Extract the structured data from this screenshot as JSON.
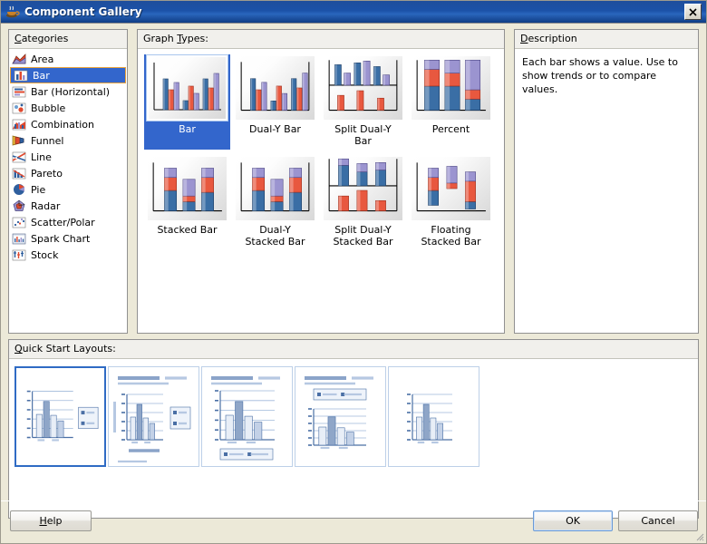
{
  "window": {
    "title": "Component Gallery",
    "icon": "java-coffee-cup-icon",
    "close_label": "✕"
  },
  "categories": {
    "header": "Categories",
    "header_mnemonic": "C",
    "selected": "Bar",
    "items": [
      {
        "label": "Area",
        "icon": "area-chart-icon"
      },
      {
        "label": "Bar",
        "icon": "bar-chart-icon"
      },
      {
        "label": "Bar (Horizontal)",
        "icon": "horizontal-bar-chart-icon"
      },
      {
        "label": "Bubble",
        "icon": "bubble-chart-icon"
      },
      {
        "label": "Combination",
        "icon": "combination-chart-icon"
      },
      {
        "label": "Funnel",
        "icon": "funnel-chart-icon"
      },
      {
        "label": "Line",
        "icon": "line-chart-icon"
      },
      {
        "label": "Pareto",
        "icon": "pareto-chart-icon"
      },
      {
        "label": "Pie",
        "icon": "pie-chart-icon"
      },
      {
        "label": "Radar",
        "icon": "radar-chart-icon"
      },
      {
        "label": "Scatter/Polar",
        "icon": "scatter-chart-icon"
      },
      {
        "label": "Spark Chart",
        "icon": "spark-chart-icon"
      },
      {
        "label": "Stock",
        "icon": "stock-chart-icon"
      }
    ]
  },
  "graph_types": {
    "header": "Graph Types:",
    "header_mnemonic": "T",
    "selected": "Bar",
    "items": [
      {
        "label": "Bar",
        "thumb": "bar"
      },
      {
        "label": "Dual-Y Bar",
        "thumb": "dual-y-bar"
      },
      {
        "label": "Split Dual-Y\nBar",
        "thumb": "split-dual-y-bar"
      },
      {
        "label": "Percent",
        "thumb": "percent"
      },
      {
        "label": "Stacked Bar",
        "thumb": "stacked-bar"
      },
      {
        "label": "Dual-Y\nStacked Bar",
        "thumb": "dual-y-stacked-bar"
      },
      {
        "label": "Split Dual-Y\nStacked Bar",
        "thumb": "split-dual-y-stacked-bar"
      },
      {
        "label": "Floating\nStacked Bar",
        "thumb": "floating-stacked-bar"
      }
    ]
  },
  "description": {
    "header": "Description",
    "header_mnemonic": "D",
    "text": "Each bar shows a value. Use to show trends or to compare values."
  },
  "quick_start": {
    "header": "Quick Start Layouts:",
    "header_mnemonic": "Q",
    "selected_index": 0,
    "layouts": [
      {
        "name": "chart-with-right-legend"
      },
      {
        "name": "titled-chart-with-right-legend"
      },
      {
        "name": "titled-chart-with-bottom-legend"
      },
      {
        "name": "titled-chart-with-top-legend"
      },
      {
        "name": "plain-chart"
      }
    ]
  },
  "buttons": {
    "help": {
      "label": "Help",
      "mnemonic": "H"
    },
    "ok": {
      "label": "OK",
      "mnemonic": ""
    },
    "cancel": {
      "label": "Cancel",
      "mnemonic": ""
    }
  },
  "colors": {
    "series_blue": "#3a6ea5",
    "series_red": "#e8583f",
    "series_purple": "#9b94d0",
    "selection_blue": "#3366cc",
    "focus_orange": "#e8a33d",
    "titlebar_blue": "#1c52a8"
  }
}
